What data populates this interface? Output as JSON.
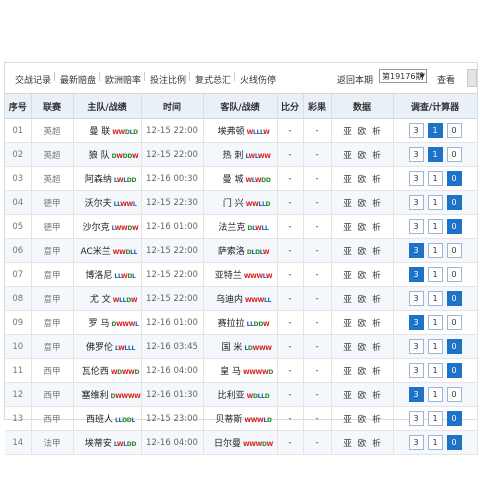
{
  "toolbar": {
    "links": [
      "交战记录",
      "最新赔盘",
      "欧洲赔率",
      "投注比例",
      "复式总汇",
      "火线伤停"
    ],
    "back_label": "返回本期",
    "period_value": "第19176期",
    "view_label": "查看"
  },
  "headers": [
    "序号",
    "联赛",
    "主队/战绩",
    "时间",
    "客队/战绩",
    "比分",
    "彩果",
    "数据",
    "调查/计算器"
  ],
  "analysis_labels": [
    "亚",
    "欧",
    "析"
  ],
  "calc_labels": [
    "3",
    "1",
    "0"
  ],
  "colors": {
    "win": "#d32020",
    "draw": "#2a8a2a",
    "loss": "#2060b0",
    "active": "#1c73c8"
  },
  "rows": [
    {
      "no": "01",
      "league": "英超",
      "home": "曼 联",
      "home_form": "WWDLD",
      "time": "12-15 22:00",
      "away": "埃弗顿",
      "away_form": "WLLLW",
      "score": "-",
      "result": "-",
      "active": "1"
    },
    {
      "no": "02",
      "league": "英超",
      "home": "狼 队",
      "home_form": "DWDDW",
      "time": "12-15 22:00",
      "away": "热 刺",
      "away_form": "LWLWW",
      "score": "-",
      "result": "-",
      "active": "1"
    },
    {
      "no": "03",
      "league": "英超",
      "home": "阿森纳",
      "home_form": "LWLDD",
      "time": "12-16 00:30",
      "away": "曼 城",
      "away_form": "WLWDD",
      "score": "-",
      "result": "-",
      "active": "0"
    },
    {
      "no": "04",
      "league": "德甲",
      "home": "沃尔夫",
      "home_form": "LLWWL",
      "time": "12-15 22:30",
      "away": "门 兴",
      "away_form": "WWLLD",
      "score": "-",
      "result": "-",
      "active": "0"
    },
    {
      "no": "05",
      "league": "德甲",
      "home": "沙尔克",
      "home_form": "LWWDW",
      "time": "12-16 01:00",
      "away": "法兰克",
      "away_form": "DLWLL",
      "score": "-",
      "result": "-",
      "active": "0"
    },
    {
      "no": "06",
      "league": "意甲",
      "home": "AC米兰",
      "home_form": "WWDLL",
      "time": "12-15 22:00",
      "away": "萨索洛",
      "away_form": "DLDLW",
      "score": "-",
      "result": "-",
      "active": "3"
    },
    {
      "no": "07",
      "league": "意甲",
      "home": "博洛尼",
      "home_form": "LLWDL",
      "time": "12-15 22:00",
      "away": "亚特兰",
      "away_form": "WWWLW",
      "score": "-",
      "result": "-",
      "active": "3"
    },
    {
      "no": "08",
      "league": "意甲",
      "home": "尤 文",
      "home_form": "WLLDW",
      "time": "12-15 22:00",
      "away": "乌迪内",
      "away_form": "WWWLL",
      "score": "-",
      "result": "-",
      "active": "0"
    },
    {
      "no": "09",
      "league": "意甲",
      "home": "罗 马",
      "home_form": "DWWWL",
      "time": "12-16 01:00",
      "away": "赛拉拉",
      "away_form": "LLDDW",
      "score": "-",
      "result": "-",
      "active": "3"
    },
    {
      "no": "10",
      "league": "意甲",
      "home": "佛罗伦",
      "home_form": "LWLLL",
      "time": "12-16 03:45",
      "away": "国 米",
      "away_form": "LDWWW",
      "score": "-",
      "result": "-",
      "active": "0"
    },
    {
      "no": "11",
      "league": "西甲",
      "home": "瓦伦西",
      "home_form": "WDWWD",
      "time": "12-16 04:00",
      "away": "皇 马",
      "away_form": "WWWWD",
      "score": "-",
      "result": "-",
      "active": "0"
    },
    {
      "no": "12",
      "league": "西甲",
      "home": "塞维利",
      "home_form": "DWWWW",
      "time": "12-16 01:30",
      "away": "比利亚",
      "away_form": "WDLLD",
      "score": "-",
      "result": "-",
      "active": "3"
    },
    {
      "no": "13",
      "league": "西甲",
      "home": "西班人",
      "home_form": "LLDDL",
      "time": "12-15 23:00",
      "away": "贝蒂斯",
      "away_form": "WWWLD",
      "score": "-",
      "result": "-",
      "active": "0"
    },
    {
      "no": "14",
      "league": "法甲",
      "home": "埃蒂安",
      "home_form": "LWLDD",
      "time": "12-16 04:00",
      "away": "日尔曼",
      "away_form": "WWWDW",
      "score": "-",
      "result": "-",
      "active": "0"
    }
  ]
}
